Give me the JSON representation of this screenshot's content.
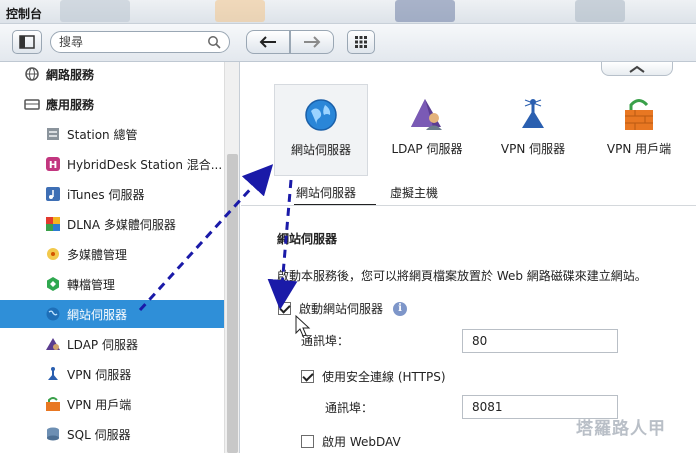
{
  "window": {
    "title": "控制台"
  },
  "search": {
    "placeholder": "搜尋"
  },
  "sidebar": {
    "items": [
      {
        "label": "網路服務",
        "kind": "category",
        "icon": "network-icon"
      },
      {
        "label": "應用服務",
        "kind": "category",
        "icon": "applications-icon"
      },
      {
        "label": "Station 總管",
        "kind": "item",
        "icon": "station-manager-icon"
      },
      {
        "label": "HybridDesk Station 混合...",
        "kind": "item",
        "icon": "hybriddesk-icon"
      },
      {
        "label": "iTunes 伺服器",
        "kind": "item",
        "icon": "itunes-icon"
      },
      {
        "label": "DLNA 多媒體伺服器",
        "kind": "item",
        "icon": "dlna-icon"
      },
      {
        "label": "多媒體管理",
        "kind": "item",
        "icon": "multimedia-icon"
      },
      {
        "label": "轉檔管理",
        "kind": "item",
        "icon": "transcode-icon"
      },
      {
        "label": "網站伺服器",
        "kind": "item",
        "icon": "web-server-icon",
        "selected": true
      },
      {
        "label": "LDAP 伺服器",
        "kind": "item",
        "icon": "ldap-icon"
      },
      {
        "label": "VPN 伺服器",
        "kind": "item",
        "icon": "vpn-server-icon"
      },
      {
        "label": "VPN 用戶端",
        "kind": "item",
        "icon": "vpn-client-icon"
      },
      {
        "label": "SQL 伺服器",
        "kind": "item",
        "icon": "sql-icon"
      }
    ]
  },
  "apps": [
    {
      "label": "網站伺服器",
      "icon": "globe-icon",
      "selected": true
    },
    {
      "label": "LDAP 伺服器",
      "icon": "ldap-icon"
    },
    {
      "label": "VPN 伺服器",
      "icon": "vpn-server-icon"
    },
    {
      "label": "VPN 用戶端",
      "icon": "vpn-client-icon"
    }
  ],
  "tabs": [
    {
      "label": "網站伺服器",
      "active": true
    },
    {
      "label": "虛擬主機",
      "active": false
    }
  ],
  "web": {
    "section_title": "網站伺服器",
    "description": "啟動本服務後，您可以將網頁檔案放置於 Web 網路磁碟來建立網站。",
    "enable_label": "啟動網站伺服器",
    "enable_checked": true,
    "port_label": "通訊埠：",
    "port_value": "80",
    "https_label": "使用安全連線 (HTTPS)",
    "https_checked": true,
    "https_port_label": "通訊埠：",
    "https_port_value": "8081",
    "webdav_label": "啟用 WebDAV",
    "webdav_checked": false,
    "info_glyph": "i"
  },
  "watermark": "塔羅路人甲",
  "colors": {
    "selection": "#2f8fd8",
    "arrow": "#1a1aa8",
    "accent": "#2b78c9"
  }
}
